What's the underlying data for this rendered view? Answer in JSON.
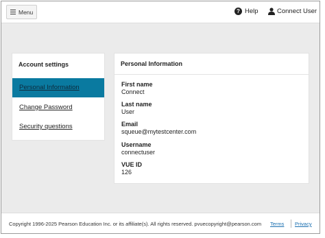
{
  "header": {
    "menu_label": "Menu",
    "help_label": "Help",
    "user_label": "Connect User"
  },
  "sidebar": {
    "title": "Account settings",
    "items": [
      {
        "label": "Personal Information",
        "active": true
      },
      {
        "label": "Change Password",
        "active": false
      },
      {
        "label": "Security questions",
        "active": false
      }
    ]
  },
  "main": {
    "title": "Personal Information",
    "fields": [
      {
        "label": "First name",
        "value": "Connect"
      },
      {
        "label": "Last name",
        "value": "User"
      },
      {
        "label": "Email",
        "value": "squeue@mytestcenter.com"
      },
      {
        "label": "Username",
        "value": "connectuser"
      },
      {
        "label": "VUE ID",
        "value": "126"
      }
    ]
  },
  "footer": {
    "copyright": "Copyright 1996-2025 Pearson Education Inc. or its affiliate(s). All rights reserved. pvuecopyright@pearson.com",
    "terms_label": "Terms",
    "privacy_label": "Privacy"
  },
  "colors": {
    "accent": "#0a7aa0",
    "link": "#1a6fb0",
    "page_bg": "#ebebeb"
  },
  "icons": [
    "hamburger-icon",
    "help-icon",
    "user-icon"
  ]
}
